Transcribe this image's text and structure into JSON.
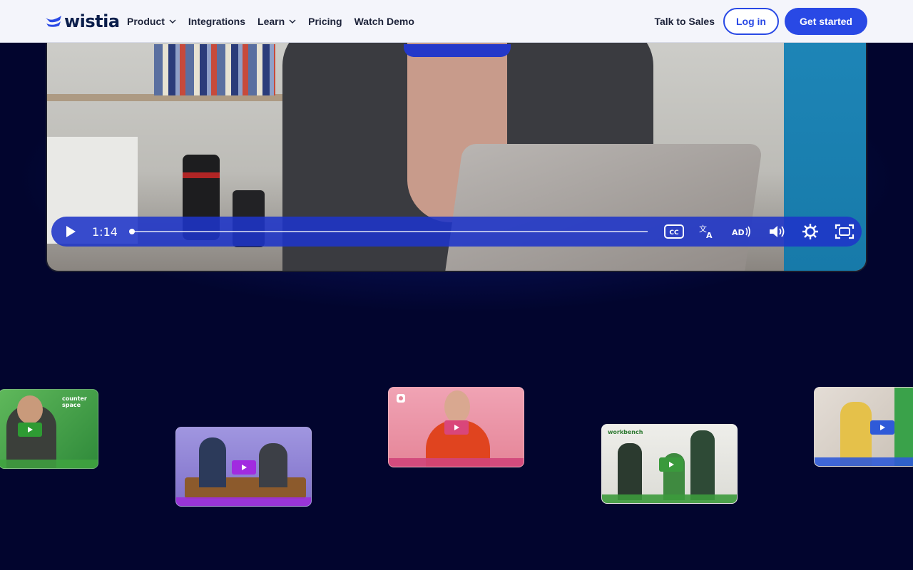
{
  "brand": {
    "name": "wistia",
    "accent": "#2949e5",
    "background": "#02052e"
  },
  "nav": {
    "items": [
      {
        "label": "Product",
        "has_dropdown": true
      },
      {
        "label": "Integrations",
        "has_dropdown": false
      },
      {
        "label": "Learn",
        "has_dropdown": true
      },
      {
        "label": "Pricing",
        "has_dropdown": false
      },
      {
        "label": "Watch Demo",
        "has_dropdown": false
      }
    ],
    "talk_to_sales": "Talk to Sales",
    "login": "Log in",
    "get_started": "Get started"
  },
  "player": {
    "time": "1:14",
    "progress": 0.0,
    "controls": [
      "play-icon",
      "captions-icon",
      "translate-icon",
      "audio-description-icon",
      "volume-icon",
      "settings-icon",
      "fullscreen-icon"
    ]
  },
  "thumbnails": [
    {
      "name": "thumb-counter-space",
      "logo": "counter\nspace",
      "theme": "#3a9a3a",
      "bar": "#3fa340"
    },
    {
      "name": "thumb-podcast",
      "logo": "",
      "theme": "#8a7ad6",
      "bar": "#9b2fd8"
    },
    {
      "name": "thumb-pink",
      "logo": "",
      "theme": "#e88ea0",
      "bar": "#d0457a"
    },
    {
      "name": "thumb-workbench",
      "logo": "workbench",
      "theme": "#e6e6e2",
      "bar": "#3c9a3c"
    },
    {
      "name": "thumb-party",
      "logo": "",
      "theme": "#d9d4cf",
      "bar": "#2f5ad8"
    }
  ]
}
